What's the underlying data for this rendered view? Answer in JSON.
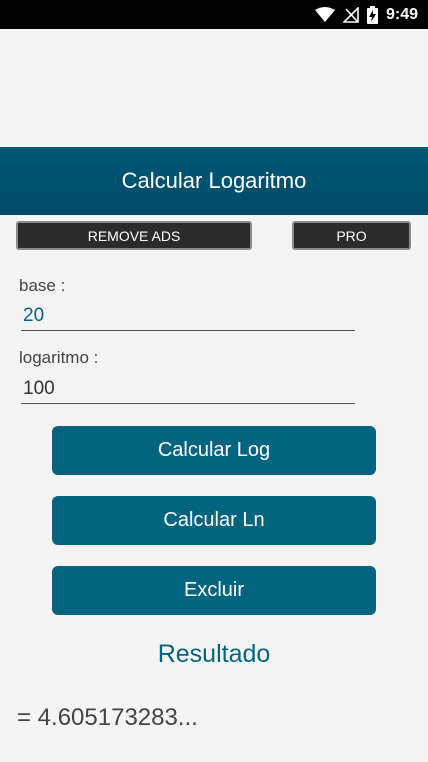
{
  "status_bar": {
    "time": "9:49",
    "icons": [
      "wifi-icon",
      "no-signal-icon",
      "battery-charging-icon"
    ]
  },
  "app_bar": {
    "title": "Calcular Logaritmo"
  },
  "top_buttons": {
    "remove_ads_label": "REMOVE ADS",
    "pro_label": "PRO"
  },
  "form": {
    "base_label": "base :",
    "base_value": "20",
    "logaritmo_label": "logaritmo :",
    "logaritmo_value": "100"
  },
  "actions": {
    "calc_log_label": "Calcular Log",
    "calc_ln_label": "Calcular Ln",
    "clear_label": "Excluir"
  },
  "result": {
    "title": "Resultado",
    "value": "= 4.605173283..."
  },
  "colors": {
    "primary": "#04647f",
    "app_bar": "#005978",
    "background": "#f4f4f4"
  }
}
